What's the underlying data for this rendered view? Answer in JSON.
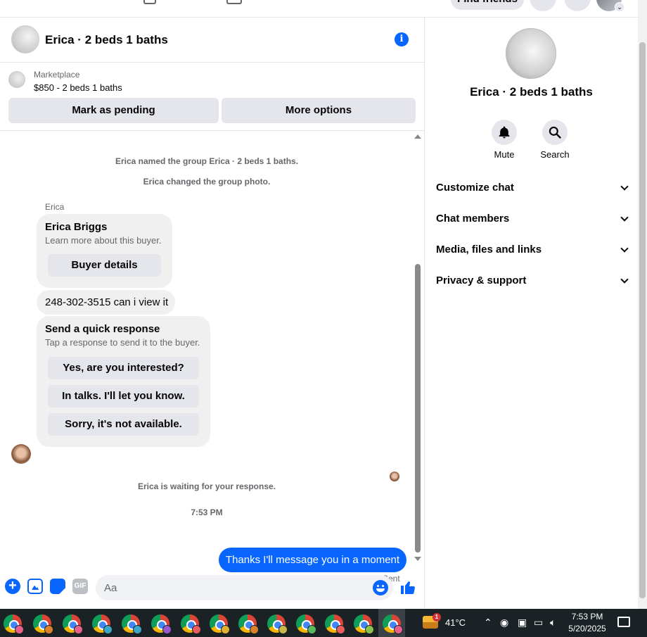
{
  "topbar": {
    "find_friends": "Find friends"
  },
  "chat": {
    "title": "Erica · 2 beds 1 baths",
    "listing": {
      "source": "Marketplace",
      "price_title": "$850 - 2 beds 1 baths"
    },
    "buttons": {
      "mark_pending": "Mark as pending",
      "more_options": "More options"
    },
    "system_messages": {
      "named_group": "Erica named the group Erica · 2 beds 1 baths.",
      "changed_photo": "Erica changed the group photo.",
      "waiting": "Erica is waiting for your response."
    },
    "sender_name": "Erica",
    "buyer_card": {
      "name": "Erica Briggs",
      "subtitle": "Learn more about this buyer.",
      "button": "Buyer details"
    },
    "incoming_message": "248-302-3515 can i view it",
    "quick_response": {
      "title": "Send a quick response",
      "subtitle": "Tap a response to send it to the buyer.",
      "options": [
        "Yes, are you interested?",
        "In talks. I'll let you know.",
        "Sorry, it's not available."
      ]
    },
    "timestamp": "7:53 PM",
    "outgoing_message": "Thanks I'll message you in a moment",
    "delivery_status": "Sent",
    "composer": {
      "placeholder": "Aa",
      "gif_label": "GIF"
    }
  },
  "details": {
    "title": "Erica · 2 beds 1 baths",
    "actions": [
      {
        "label": "Mute",
        "icon": "bell-icon"
      },
      {
        "label": "Search",
        "icon": "search-icon"
      }
    ],
    "sections": [
      "Customize chat",
      "Chat members",
      "Media, files and links",
      "Privacy & support"
    ]
  },
  "taskbar": {
    "weather_badge": "1",
    "temperature": "41°C",
    "time": "7:53 PM",
    "date": "5/20/2025"
  },
  "colors": {
    "accent": "#0866ff",
    "bubble_gray": "#f0f0f0",
    "button_gray": "#e4e6eb"
  }
}
